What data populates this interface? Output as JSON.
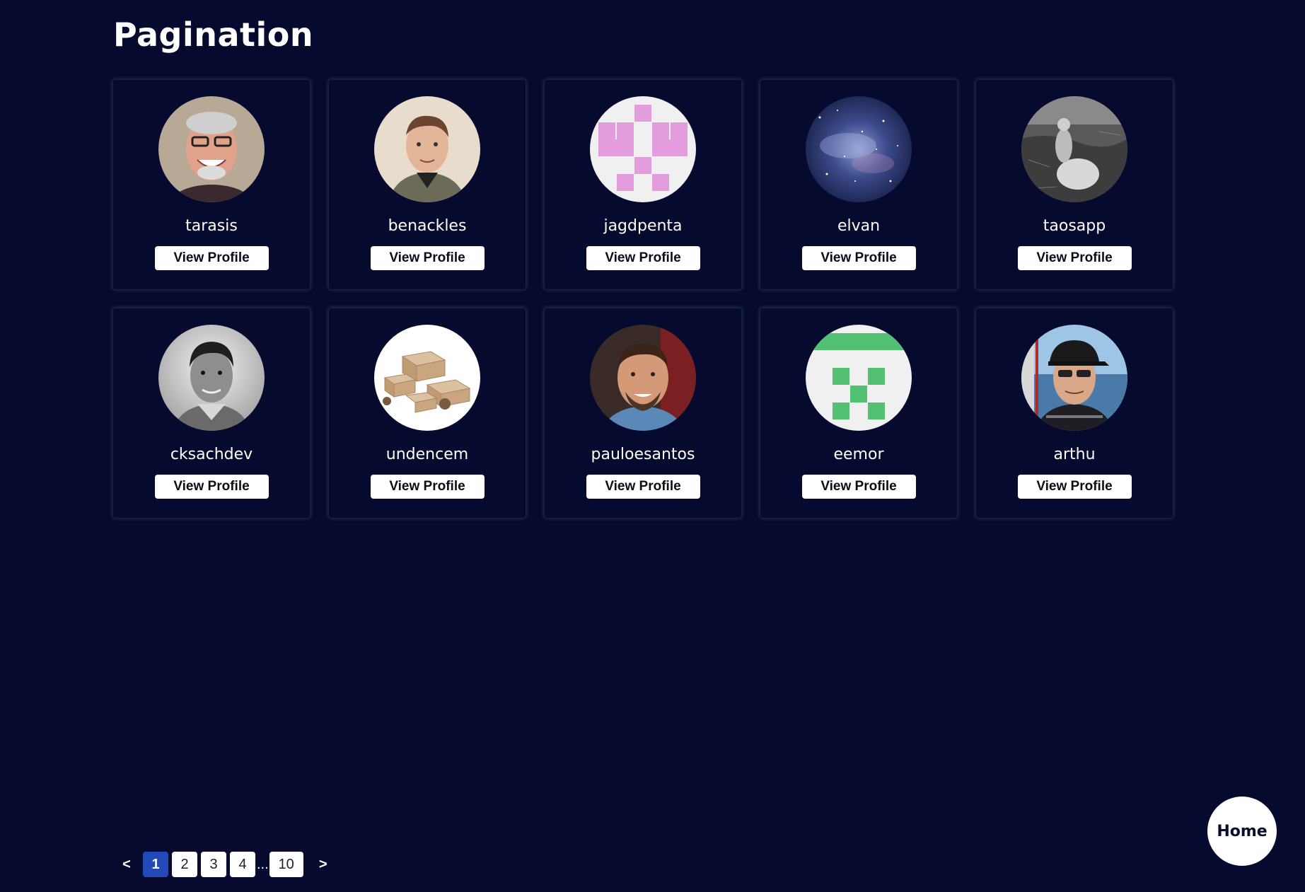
{
  "page": {
    "title": "Pagination"
  },
  "users": [
    {
      "username": "tarasis",
      "button": "View Profile",
      "avatar": "person-gray-hair-glasses-photo"
    },
    {
      "username": "benackles",
      "button": "View Profile",
      "avatar": "person-short-hair-photo"
    },
    {
      "username": "jagdpenta",
      "button": "View Profile",
      "avatar": "pink-identicon"
    },
    {
      "username": "elvan",
      "button": "View Profile",
      "avatar": "galaxy-nebula-photo"
    },
    {
      "username": "taosapp",
      "button": "View Profile",
      "avatar": "grayscale-figure-photo"
    },
    {
      "username": "cksachdev",
      "button": "View Profile",
      "avatar": "person-grayscale-photo"
    },
    {
      "username": "undencem",
      "button": "View Profile",
      "avatar": "cardboard-boxes-photo"
    },
    {
      "username": "pauloesantos",
      "button": "View Profile",
      "avatar": "person-beard-photo"
    },
    {
      "username": "eemor",
      "button": "View Profile",
      "avatar": "green-identicon"
    },
    {
      "username": "arthu",
      "button": "View Profile",
      "avatar": "person-cap-sunglasses-photo"
    }
  ],
  "pagination": {
    "prev": "<",
    "next": ">",
    "pages": [
      "1",
      "2",
      "3",
      "4"
    ],
    "ellipsis": "...",
    "last": "10",
    "current": "1"
  },
  "home": {
    "label": "Home"
  },
  "colors": {
    "background": "#050a2e",
    "active_page": "#2149b8",
    "pink_identicon": "#e39ddc",
    "green_identicon": "#52c171"
  }
}
